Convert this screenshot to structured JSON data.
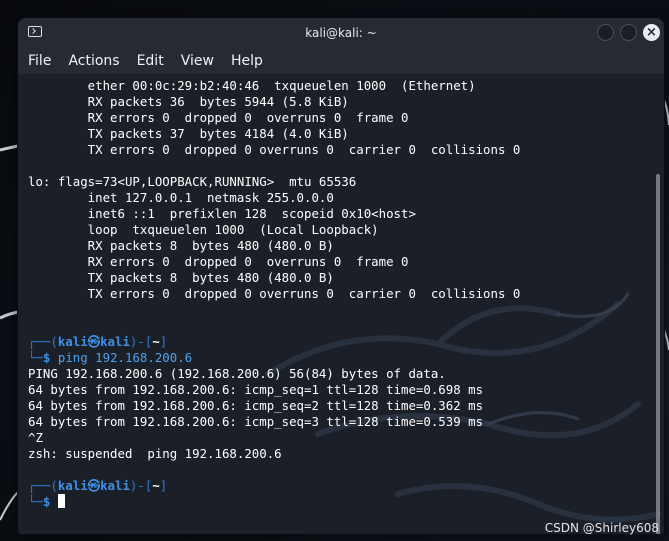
{
  "window": {
    "title": "kali@kali: ~",
    "icon": "terminal-icon",
    "buttons": [
      "minimize-icon",
      "maximize-icon",
      "close-icon"
    ],
    "close_glyph": "×"
  },
  "menu": [
    "File",
    "Actions",
    "Edit",
    "View",
    "Help"
  ],
  "terminal": {
    "lines": [
      {
        "type": "text",
        "text": "        ether 00:0c:29:b2:40:46  txqueuelen 1000  (Ethernet)"
      },
      {
        "type": "text",
        "text": "        RX packets 36  bytes 5944 (5.8 KiB)"
      },
      {
        "type": "text",
        "text": "        RX errors 0  dropped 0  overruns 0  frame 0"
      },
      {
        "type": "text",
        "text": "        TX packets 37  bytes 4184 (4.0 KiB)"
      },
      {
        "type": "text",
        "text": "        TX errors 0  dropped 0 overruns 0  carrier 0  collisions 0"
      },
      {
        "type": "text",
        "text": ""
      },
      {
        "type": "text",
        "text": "lo: flags=73<UP,LOOPBACK,RUNNING>  mtu 65536"
      },
      {
        "type": "text",
        "text": "        inet 127.0.0.1  netmask 255.0.0.0"
      },
      {
        "type": "text",
        "text": "        inet6 ::1  prefixlen 128  scopeid 0x10<host>"
      },
      {
        "type": "text",
        "text": "        loop  txqueuelen 1000  (Local Loopback)"
      },
      {
        "type": "text",
        "text": "        RX packets 8  bytes 480 (480.0 B)"
      },
      {
        "type": "text",
        "text": "        RX errors 0  dropped 0  overruns 0  frame 0"
      },
      {
        "type": "text",
        "text": "        TX packets 8  bytes 480 (480.0 B)"
      },
      {
        "type": "text",
        "text": "        TX errors 0  dropped 0 overruns 0  carrier 0  collisions 0"
      },
      {
        "type": "text",
        "text": ""
      },
      {
        "type": "text",
        "text": ""
      },
      {
        "type": "prompt-top",
        "user": "kali",
        "host": "kali",
        "dir": "~"
      },
      {
        "type": "prompt-cmd",
        "command": "ping",
        "args": " 192.168.200.6"
      },
      {
        "type": "text",
        "text": "PING 192.168.200.6 (192.168.200.6) 56(84) bytes of data."
      },
      {
        "type": "text",
        "text": "64 bytes from 192.168.200.6: icmp_seq=1 ttl=128 time=0.698 ms"
      },
      {
        "type": "text",
        "text": "64 bytes from 192.168.200.6: icmp_seq=2 ttl=128 time=0.362 ms"
      },
      {
        "type": "text",
        "text": "64 bytes from 192.168.200.6: icmp_seq=3 ttl=128 time=0.539 ms"
      },
      {
        "type": "text",
        "text": "^Z"
      },
      {
        "type": "text",
        "text": "zsh: suspended  ping 192.168.200.6"
      },
      {
        "type": "text",
        "text": ""
      },
      {
        "type": "prompt-top",
        "user": "kali",
        "host": "kali",
        "dir": "~"
      },
      {
        "type": "prompt-cursor"
      }
    ],
    "prompt_glyphs": {
      "top_left": "┌──(",
      "skull": "㉿",
      "mid": ")-[",
      "close": "]",
      "bottom_left": "└─",
      "dollar": "$"
    }
  },
  "colors": {
    "prompt_blue": "#3f90e6",
    "command_blue": "#4ea1ee",
    "text": "#ffffff",
    "background": "#1c2029"
  },
  "watermark": "CSDN @Shirley608"
}
